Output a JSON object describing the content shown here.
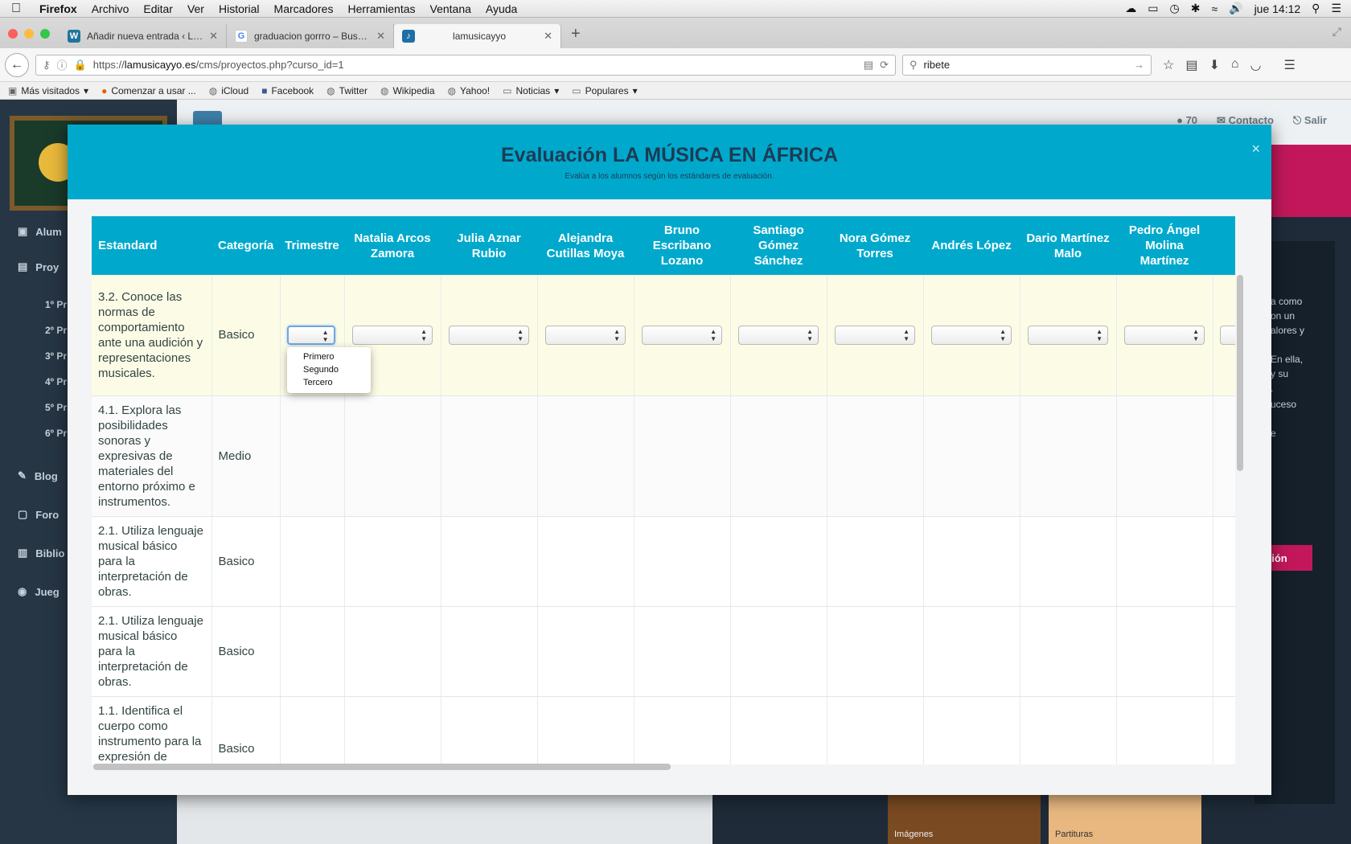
{
  "menubar": {
    "app": "Firefox",
    "items": [
      "Archivo",
      "Editar",
      "Ver",
      "Historial",
      "Marcadores",
      "Herramientas",
      "Ventana",
      "Ayuda"
    ],
    "clock": "jue 14:12"
  },
  "tabs": [
    {
      "title": "Añadir nueva entrada ‹ La ...",
      "favicon": "wordpress-icon",
      "active": false
    },
    {
      "title": "graduacion gorrro – Busca...",
      "favicon": "google-icon",
      "active": false
    },
    {
      "title": "lamusicayyo",
      "favicon": "site-icon",
      "active": true
    }
  ],
  "navbar": {
    "url_prefix": "https://",
    "url_domain": "lamusicayyo.es",
    "url_path": "/cms/proyectos.php?curso_id=1",
    "search_value": "ribete"
  },
  "bookmarks": [
    "Más visitados",
    "Comenzar a usar ...",
    "iCloud",
    "Facebook",
    "Twitter",
    "Wikipedia",
    "Yahoo!",
    "Noticias",
    "Populares"
  ],
  "background": {
    "sidebar": {
      "items": [
        "Alum",
        "Proy",
        "Blog",
        "Foro",
        "Biblio",
        "Jueg"
      ],
      "sub_items": [
        "1º Pr",
        "2º Pr",
        "3º Pr",
        "4º Pr",
        "5º Pr",
        "6º Pr"
      ]
    },
    "header_links": [
      "Contacto",
      "Salir"
    ],
    "notification_count": "70",
    "partial_texts": [
      "a como",
      "on un",
      "alores y",
      "En ella,",
      "y su",
      ".",
      "uceso",
      "e"
    ],
    "cta_label": "ción",
    "card_labels": [
      "Imágenes",
      "Partituras"
    ]
  },
  "modal": {
    "title": "Evaluación LA MÚSICA EN ÁFRICA",
    "subtitle": "Evalúa a los alumnos según los estándares de evaluación.",
    "columns": [
      "Estandard",
      "Categoría",
      "Trimestre",
      "Natalia Arcos Zamora",
      "Julia Aznar Rubio",
      "Alejandra Cutillas Moya",
      "Bruno Escribano Lozano",
      "Santiago Gómez Sánchez",
      "Nora Gómez Torres",
      "Andrés López",
      "Dario Martínez Malo",
      "Pedro Ángel Molina Martínez"
    ],
    "rows": [
      {
        "standard": "3.2. Conoce las normas de comportamiento ante una audición y representaciones musicales.",
        "category": "Basico"
      },
      {
        "standard": "4.1. Explora las posibilidades sonoras y expresivas de materiales del entorno próximo e instrumentos.",
        "category": "Medio"
      },
      {
        "standard": "2.1.  Utiliza lenguaje musical básico para la interpretación de obras.",
        "category": "Basico"
      },
      {
        "standard": "2.1.  Utiliza lenguaje musical básico para la interpretación de obras.",
        "category": "Basico"
      },
      {
        "standard": "1.1.  Identifica el cuerpo como instrumento para la expresión de",
        "category": "Basico"
      }
    ],
    "trimestre_options": [
      "Primero",
      "Segundo",
      "Tercero"
    ]
  }
}
